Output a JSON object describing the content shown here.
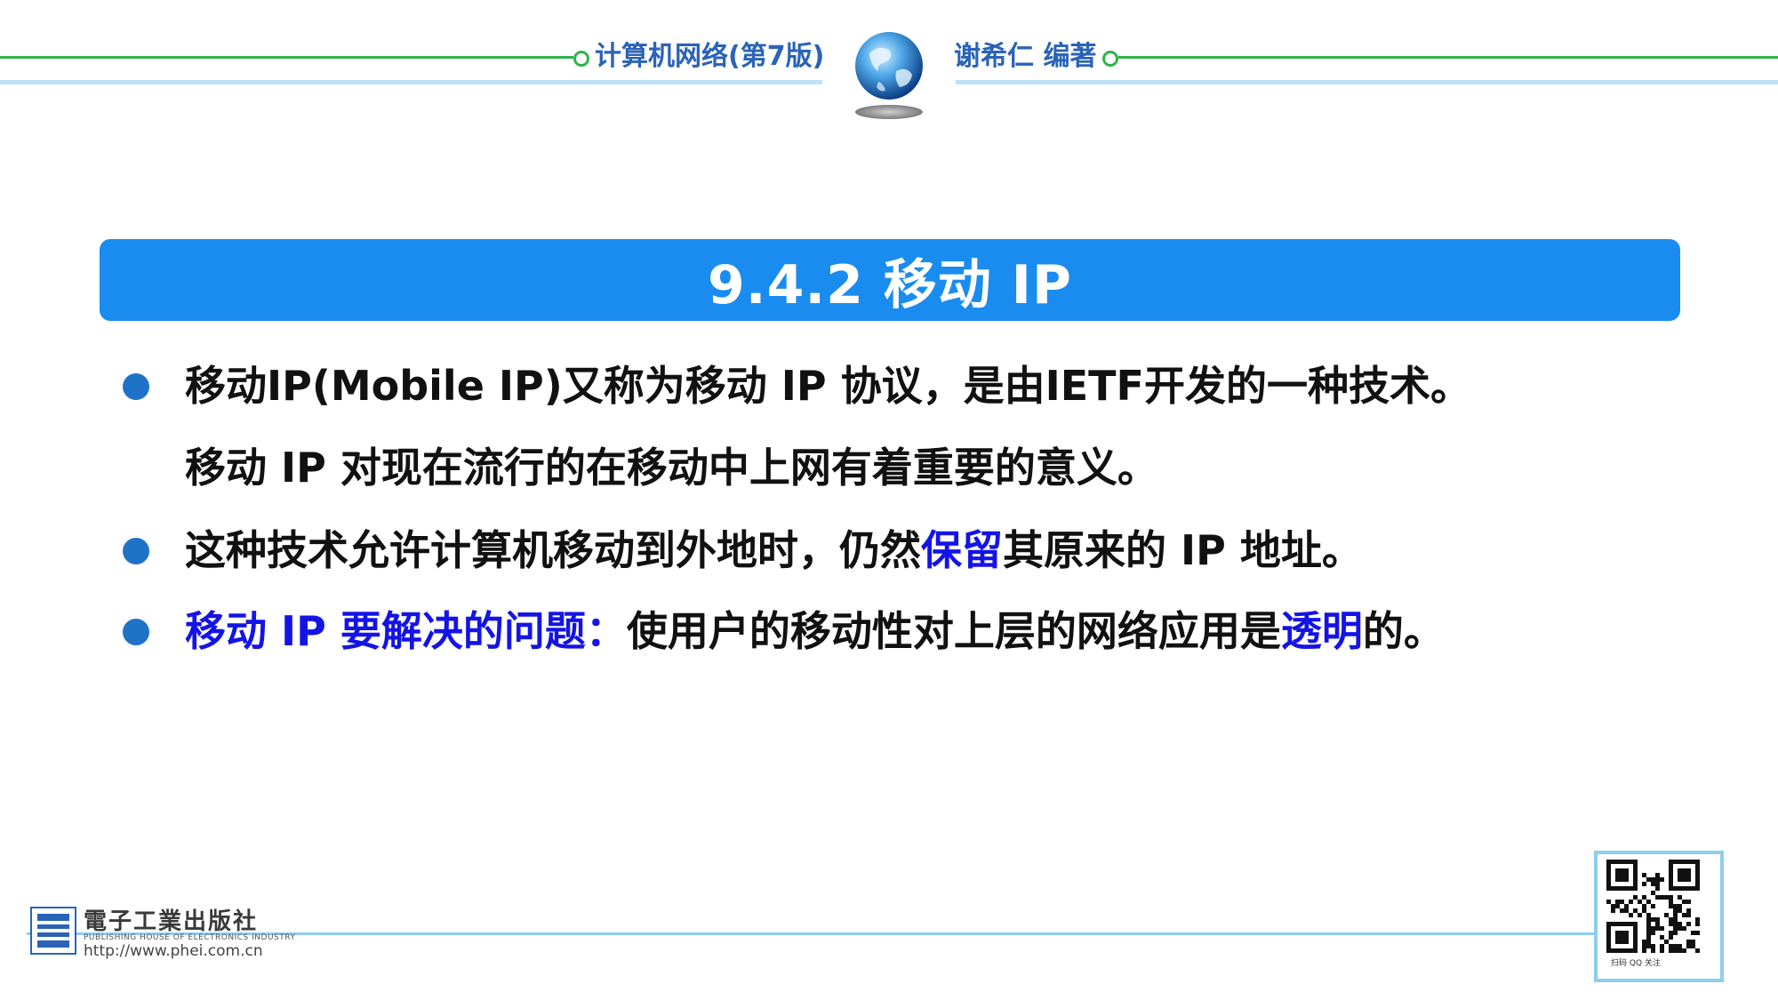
{
  "header": {
    "book_title": "计算机网络(第7版)",
    "author": "谢希仁 编著",
    "globe_icon": "globe-icon",
    "accent_green": "#2fb34a",
    "accent_blue": "#2a63b8"
  },
  "slide": {
    "title": "9.4.2 移动 IP",
    "title_bg": "#1a8cf0",
    "bullets": [
      {
        "line1": "移动IP(Mobile IP)又称为移动 IP 协议，是由IETF开发的一种技术。",
        "line2": "移动 IP 对现在流行的在移动中上网有着重要的意义。"
      },
      {
        "part1": "这种技术允许计算机移动到外地时，仍然",
        "highlight": "保留",
        "part2": "其原来的 IP 地址。"
      },
      {
        "highlight1": "移动 IP 要解决的问题：",
        "part1": "使用户的移动性对上层的网络应用是",
        "highlight2": "透明",
        "part2": "的。"
      }
    ],
    "highlight_color": "#1414e6"
  },
  "footer": {
    "publisher_name": "電子工業出版社",
    "publisher_en": "PUBLISHING HOUSE OF ELECTRONICS INDUSTRY",
    "publisher_url": "http://www.phei.com.cn",
    "logo_icon": "publisher-logo-icon",
    "qr_icon": "qr-code-icon",
    "qr_caption": "扫码 QQ 关注"
  }
}
